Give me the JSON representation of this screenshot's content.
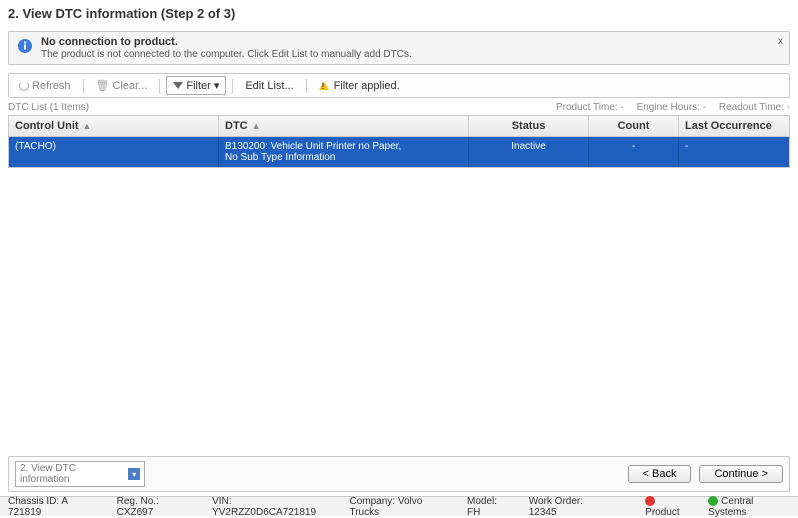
{
  "header": {
    "title": "2. View DTC information (Step 2 of 3)"
  },
  "banner": {
    "title": "No connection to product.",
    "subtitle": "The product is not connected to the computer. Click Edit List to manually add DTCs."
  },
  "toolbar": {
    "refresh": "Refresh",
    "clear": "Clear...",
    "filter": "Filter",
    "editList": "Edit List...",
    "filterApplied": "Filter applied."
  },
  "meta": {
    "listLabel": "DTC List (1 Items)",
    "productTime": "Product Time: -",
    "engineHours": "Engine Hours: -",
    "readoutTime": "Readout Time: -"
  },
  "columns": {
    "controlUnit": "Control Unit",
    "dtc": "DTC",
    "status": "Status",
    "count": "Count",
    "lastOccurrence": "Last Occurrence"
  },
  "rows": [
    {
      "controlUnit": "(TACHO)",
      "dtcLine1": "B130200: Vehicle Unit Printer no Paper,",
      "dtcLine2": "No Sub Type Information",
      "status": "Inactive",
      "count": "-",
      "last": "-"
    }
  ],
  "footer": {
    "stepLabel": "2. View DTC information",
    "back": "< Back",
    "continue": "Continue >"
  },
  "statusbar": {
    "chassis": "Chassis ID: A 721819",
    "reg": "Reg. No.: CXZ697",
    "vin": "VIN: YV2RZZ0D6CA721819",
    "company": "Company: Volvo Trucks",
    "model": "Model: FH",
    "workOrder": "Work Order: 12345",
    "product": "Product",
    "central": "Central Systems"
  }
}
